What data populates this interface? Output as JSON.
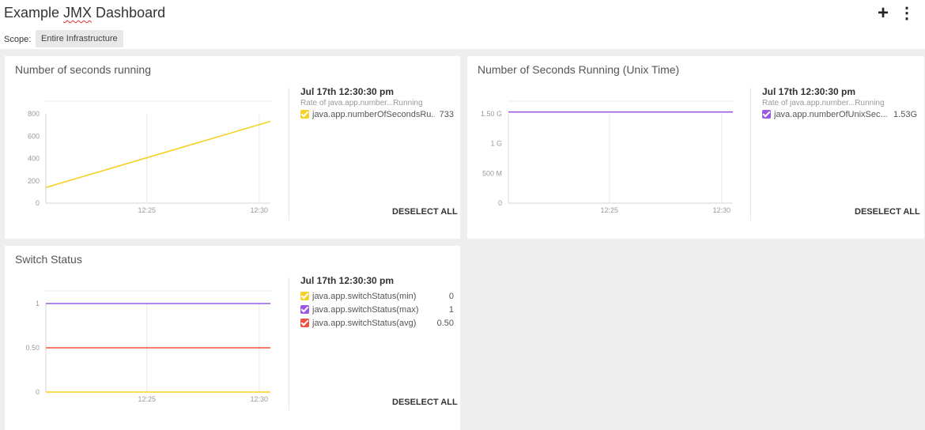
{
  "header": {
    "title_prefix": "Example ",
    "title_jmx": "JMX",
    "title_suffix": " Dashboard",
    "add_label": "+",
    "more_label": "⋮",
    "scope_label": "Scope:",
    "scope_value": "Entire Infrastructure"
  },
  "colors": {
    "yellow": "#f5d125",
    "purple": "#9b59e6",
    "red": "#f2503e",
    "grid": "#e8e8e8",
    "axis_text": "#999999"
  },
  "widgets": [
    {
      "title": "Number of seconds running",
      "legend": {
        "time": "Jul 17th 12:30:30 pm",
        "subtitle": "Rate of java.app.number...Running",
        "series": [
          {
            "name": "java.app.numberOfSecondsRu...",
            "value": "733",
            "color": "#f5d125"
          }
        ]
      },
      "deselect_label": "DESELECT ALL",
      "chart_data": {
        "type": "line",
        "x_ticks": [
          "12:25",
          "12:30"
        ],
        "y_ticks": [
          "0",
          "200",
          "400",
          "600",
          "800"
        ],
        "ylim": [
          0,
          800
        ],
        "series": [
          {
            "name": "java.app.numberOfSecondsRunning",
            "x": [
              "12:20:30",
              "12:30:30"
            ],
            "values": [
              140,
              733
            ]
          }
        ]
      }
    },
    {
      "title": "Number of Seconds Running  (Unix Time)",
      "legend": {
        "time": "Jul 17th 12:30:30 pm",
        "subtitle": "Rate of java.app.number...Running",
        "series": [
          {
            "name": "java.app.numberOfUnixSec...",
            "value": "1.53G",
            "color": "#9b59e6"
          }
        ]
      },
      "deselect_label": "DESELECT ALL",
      "chart_data": {
        "type": "line",
        "x_ticks": [
          "12:25",
          "12:30"
        ],
        "y_ticks": [
          "0",
          "500 M",
          "1 G",
          "1.50 G"
        ],
        "ylim": [
          0,
          1500000000
        ],
        "series": [
          {
            "name": "java.app.numberOfUnixSeconds",
            "x": [
              "12:20:30",
              "12:30:30"
            ],
            "values": [
              1530000000,
              1530000000
            ]
          }
        ]
      }
    },
    {
      "title": "Switch Status",
      "legend": {
        "time": "Jul 17th 12:30:30 pm",
        "subtitle": "",
        "series": [
          {
            "name": "java.app.switchStatus(min)",
            "value": "0",
            "color": "#f5d125"
          },
          {
            "name": "java.app.switchStatus(max)",
            "value": "1",
            "color": "#9b59e6"
          },
          {
            "name": "java.app.switchStatus(avg)",
            "value": "0.50",
            "color": "#f2503e"
          }
        ]
      },
      "deselect_label": "DESELECT ALL",
      "chart_data": {
        "type": "line",
        "x_ticks": [
          "12:25",
          "12:30"
        ],
        "y_ticks": [
          "0",
          "0.50",
          "1"
        ],
        "ylim": [
          0,
          1
        ],
        "series": [
          {
            "name": "java.app.switchStatus(min)",
            "x": [
              "12:20:30",
              "12:30:30"
            ],
            "values": [
              0,
              0
            ]
          },
          {
            "name": "java.app.switchStatus(max)",
            "x": [
              "12:20:30",
              "12:30:30"
            ],
            "values": [
              1,
              1
            ]
          },
          {
            "name": "java.app.switchStatus(avg)",
            "x": [
              "12:20:30",
              "12:30:30"
            ],
            "values": [
              0.5,
              0.5
            ]
          }
        ]
      }
    }
  ]
}
